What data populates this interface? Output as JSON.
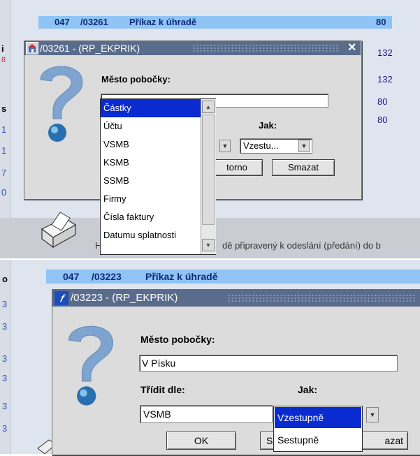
{
  "top": {
    "header": {
      "id_prefix": "047",
      "id_suffix": "/03261",
      "title": "Příkaz k úhradě",
      "value": "80"
    },
    "right_values": [
      "132",
      "132",
      "80",
      "80"
    ],
    "left_fragments": [
      "i",
      "8",
      "s",
      "1",
      "1",
      "7",
      "0"
    ],
    "dialog": {
      "title": "/03261 - (RP_EKPRIK)",
      "city_label": "Město pobočky:",
      "city_value": "",
      "how_label": "Jak:",
      "how_value": "Vzestu...",
      "storno_label": "torno",
      "clear_label": "Smazat"
    },
    "sort_list": [
      "Částky",
      "Účtu",
      "VSMB",
      "KSMB",
      "SSMB",
      "Firmy",
      "Čísla faktury",
      "Datumu splatnosti"
    ],
    "sort_selected": "Částky",
    "status_left": "H",
    "status_text": "dě připravený k odeslání (předání) do b"
  },
  "bottom": {
    "header": {
      "id_prefix": "047",
      "id_suffix": "/03223",
      "title": "Příkaz k úhradě"
    },
    "left_fragments": [
      "o",
      "3",
      "3",
      "3",
      "3",
      "3",
      "3"
    ],
    "dialog": {
      "title": "/03223 - (RP_EKPRIK)",
      "city_label": "Město pobočky:",
      "city_value": "V Písku",
      "sort_label": "Třídit dle:",
      "how_label": "Jak:",
      "sort_value": "VSMB",
      "ok_label": "OK",
      "s_label": "S",
      "clear_label": "azat"
    },
    "how_options": [
      "Vzestupně",
      "Sestupně"
    ],
    "how_selected": "Vzestupně"
  },
  "colors": {
    "header_bar": "#8fc4f5",
    "title_bar": "#5a6c8c",
    "selection": "#0a2bd0",
    "dialog": "#dcdcdc"
  }
}
